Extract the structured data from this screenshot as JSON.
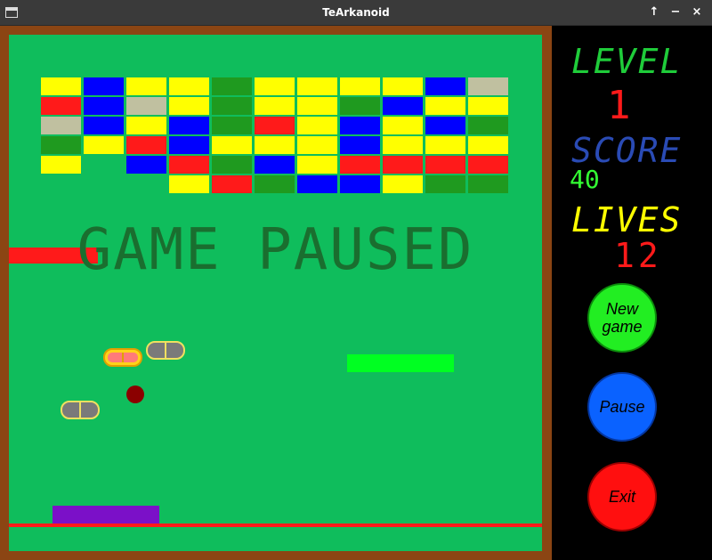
{
  "window": {
    "title": "TeArkanoid",
    "controls": [
      "↑",
      "−",
      "×"
    ]
  },
  "game": {
    "status_text": "GAME PAUSED",
    "colors": {
      "border": "#8B4513",
      "field": "#0fbd5c",
      "yellow": "#ffff00",
      "blue": "#0000ff",
      "red": "#ff1a1a",
      "green": "#1f9a1f",
      "gray": "#c0c0a0"
    },
    "bricks": [
      [
        "yellow",
        "blue",
        "yellow",
        "yellow",
        "green",
        "yellow",
        "yellow",
        "yellow",
        "yellow",
        "blue",
        "gray"
      ],
      [
        "red",
        "blue",
        "gray",
        "yellow",
        "green",
        "yellow",
        "yellow",
        "green",
        "blue",
        "yellow",
        "yellow"
      ],
      [
        "gray",
        "blue",
        "yellow",
        "blue",
        "green",
        "red",
        "yellow",
        "blue",
        "yellow",
        "blue",
        "green"
      ],
      [
        "green",
        "yellow",
        "red",
        "blue",
        "yellow",
        "yellow",
        "yellow",
        "blue",
        "yellow",
        "yellow",
        "yellow"
      ],
      [
        "yellow",
        null,
        "blue",
        "red",
        "green",
        "blue",
        "yellow",
        "red",
        "red",
        "red",
        "red"
      ],
      [
        null,
        null,
        null,
        "yellow",
        "red",
        "green",
        "blue",
        "blue",
        "yellow",
        "green",
        "green"
      ]
    ]
  },
  "sidebar": {
    "level_label": "LEVEL",
    "level_value": "1",
    "score_label": "SCORE",
    "score_value": "40",
    "lives_label": "LIVES",
    "lives_value": "12",
    "new_game_label": "New game",
    "pause_label": "Pause",
    "exit_label": "Exit"
  }
}
